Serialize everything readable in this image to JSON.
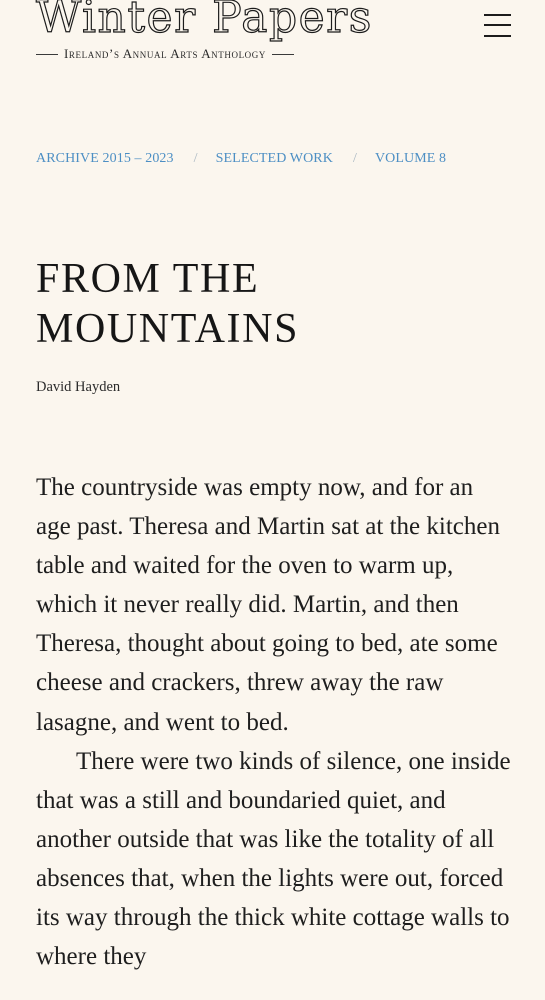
{
  "site": {
    "title": "Winter Papers",
    "tagline": "Ireland’s Annual Arts Anthology"
  },
  "header": {
    "menu_icon": "hamburger-menu-icon"
  },
  "breadcrumb": {
    "items": [
      {
        "label": "ARCHIVE 2015 – 2023"
      },
      {
        "label": "SELECTED WORK"
      },
      {
        "label": "VOLUME 8"
      }
    ],
    "separator": "/"
  },
  "article": {
    "title": "FROM THE MOUNTAINS",
    "author": "David Hayden",
    "paragraphs": [
      "The countryside was empty now, and for an age past. Theresa and Martin sat at the kitchen table and waited for the oven to warm up, which it never really did. Martin, and then Theresa, thought about going to bed, ate some cheese and crackers, threw away the raw lasagne, and went to bed.",
      "There were two kinds of silence, one inside that was a still and boundaried quiet, and another outside that was like the totality of all absences that, when the lights were out, forced its way through the thick white cottage walls to where they"
    ]
  },
  "colors": {
    "background": "#fbf6ee",
    "text": "#1c1c1c",
    "link_accent": "#4d8fc4"
  }
}
